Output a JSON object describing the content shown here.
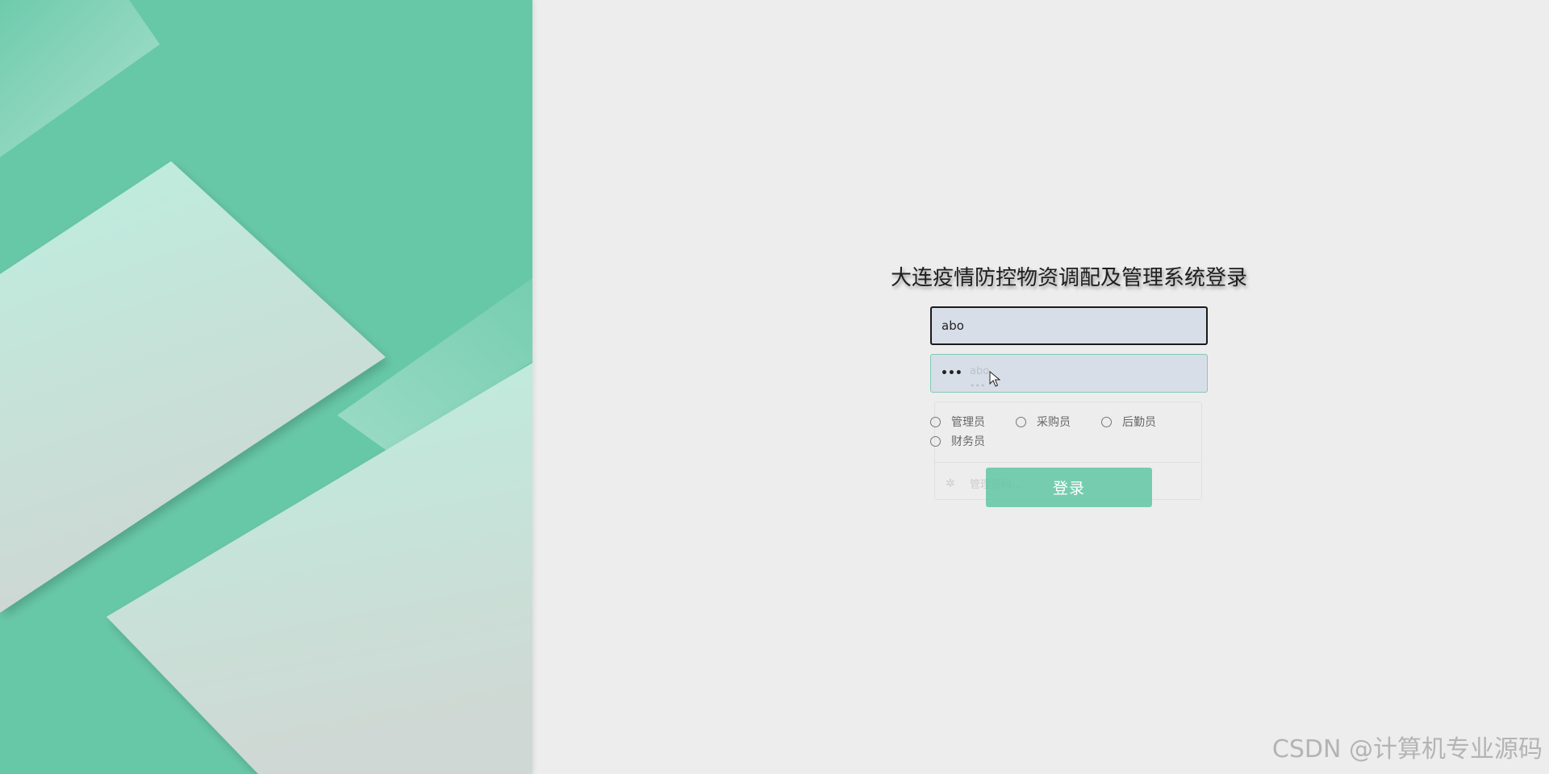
{
  "login": {
    "title": "大连疫情防控物资调配及管理系统登录",
    "username_value": "abo",
    "password_value": "•••",
    "ghost_username": "abo",
    "ghost_password": "•••",
    "ghost_link": "管理密码...",
    "roles": [
      {
        "label": "管理员"
      },
      {
        "label": "采购员"
      },
      {
        "label": "后勤员"
      },
      {
        "label": "财务员"
      }
    ],
    "login_button": "登录"
  },
  "watermark": "CSDN @计算机专业源码",
  "colors": {
    "accent": "#67c8a8",
    "button": "#5cc4a0",
    "input_bg": "#d8dee8",
    "page_bg": "#ededed"
  }
}
